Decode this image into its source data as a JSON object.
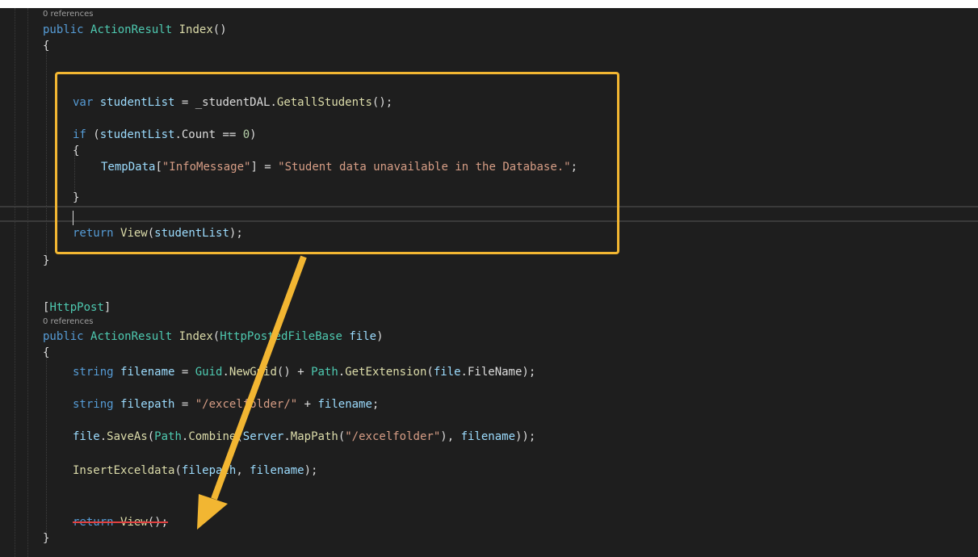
{
  "editor": {
    "codelens_1": "0 references",
    "codelens_2": "0 references",
    "block1": {
      "sig_kw": "public",
      "sig_type": "ActionResult",
      "sig_name": "Index",
      "sig_parens": "()",
      "open_brace": "{",
      "l1_kw": "var",
      "l1_var": "studentList",
      "l1_eq": " = _studentDAL.",
      "l1_fn": "GetallStudents",
      "l1_end": "();",
      "l2_kw": "if",
      "l2_open": " (",
      "l2_var": "studentList",
      "l2_prop": ".Count == ",
      "l2_num": "0",
      "l2_close": ")",
      "inner_open": "{",
      "l3_var": "TempData",
      "l3_br1": "[",
      "l3_str1": "\"InfoMessage\"",
      "l3_br2": "] = ",
      "l3_str2": "\"Student data unavailable in the Database.\"",
      "l3_end": ";",
      "inner_close": "}",
      "ret_kw": "return",
      "ret_fn": "View",
      "ret_open": "(",
      "ret_var": "studentList",
      "ret_close": ");",
      "close_brace": "}"
    },
    "block2": {
      "attr_open": "[",
      "attr_name": "HttpPost",
      "attr_close": "]",
      "sig_kw": "public",
      "sig_type": "ActionResult",
      "sig_name": "Index",
      "sig_open": "(",
      "sig_ptype": "HttpPostedFileBase",
      "sig_pname": "file",
      "sig_close": ")",
      "open_brace": "{",
      "a_kw": "string",
      "a_var": "filename",
      "a_eq": " = ",
      "a_typ1": "Guid",
      "a_dot1": ".",
      "a_fn1": "NewGuid",
      "a_mid": "() + ",
      "a_typ2": "Path",
      "a_dot2": ".",
      "a_fn2": "GetExtension",
      "a_open": "(",
      "a_var2": "file",
      "a_prop": ".FileName",
      "a_end": ");",
      "b_kw": "string",
      "b_var": "filepath",
      "b_eq": " = ",
      "b_str": "\"/excelfolder/\"",
      "b_plus": " + ",
      "b_var2": "filename",
      "b_end": ";",
      "c_var": "file",
      "c_dot": ".",
      "c_fn": "SaveAs",
      "c_open": "(",
      "c_typ": "Path",
      "c_dot2": ".",
      "c_fn2": "Combine",
      "c_open2": "(",
      "c_srv": "Server",
      "c_dot3": ".",
      "c_fn3": "MapPath",
      "c_open3": "(",
      "c_str": "\"/excelfolder\"",
      "c_mid": "), ",
      "c_var2": "filename",
      "c_end": "));",
      "d_fn": "InsertExceldata",
      "d_open": "(",
      "d_var1": "filepath",
      "d_comma": ", ",
      "d_var2": "filename",
      "d_end": ");",
      "e_kw": "return",
      "e_fn": "View",
      "e_end": "();",
      "close_brace": "}"
    }
  },
  "annotation": {
    "box_color": "#f2b632",
    "arrow_color": "#f2b632",
    "strike_color": "#e04040"
  }
}
